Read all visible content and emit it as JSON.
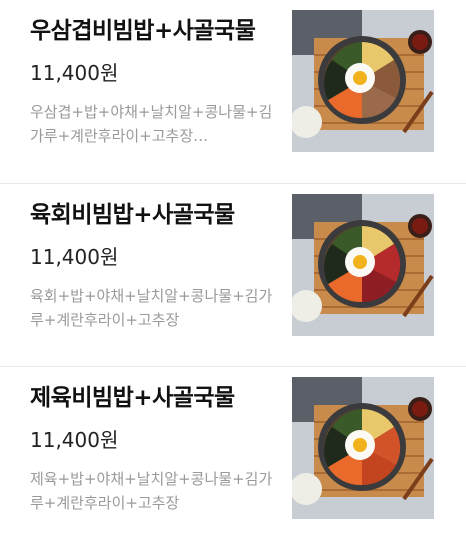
{
  "menu": {
    "items": [
      {
        "name": "우삼겹비빔밥+사골국물",
        "price": "11,400원",
        "description": "우삼겹+밥+야채+날치알+콩나물+김가루+계란후라이+고추장…",
        "image_icon": "bibimbap-photo-bulgogi"
      },
      {
        "name": "육회비빔밥+사골국물",
        "price": "11,400원",
        "description": "육회+밥+야채+날치알+콩나물+김가루+계란후라이+고추장",
        "image_icon": "bibimbap-photo-yukhoe"
      },
      {
        "name": "제육비빔밥+사골국물",
        "price": "11,400원",
        "description": "제육+밥+야채+날치알+콩나물+김가루+계란후라이+고추장",
        "image_icon": "bibimbap-photo-jeyuk"
      }
    ]
  }
}
